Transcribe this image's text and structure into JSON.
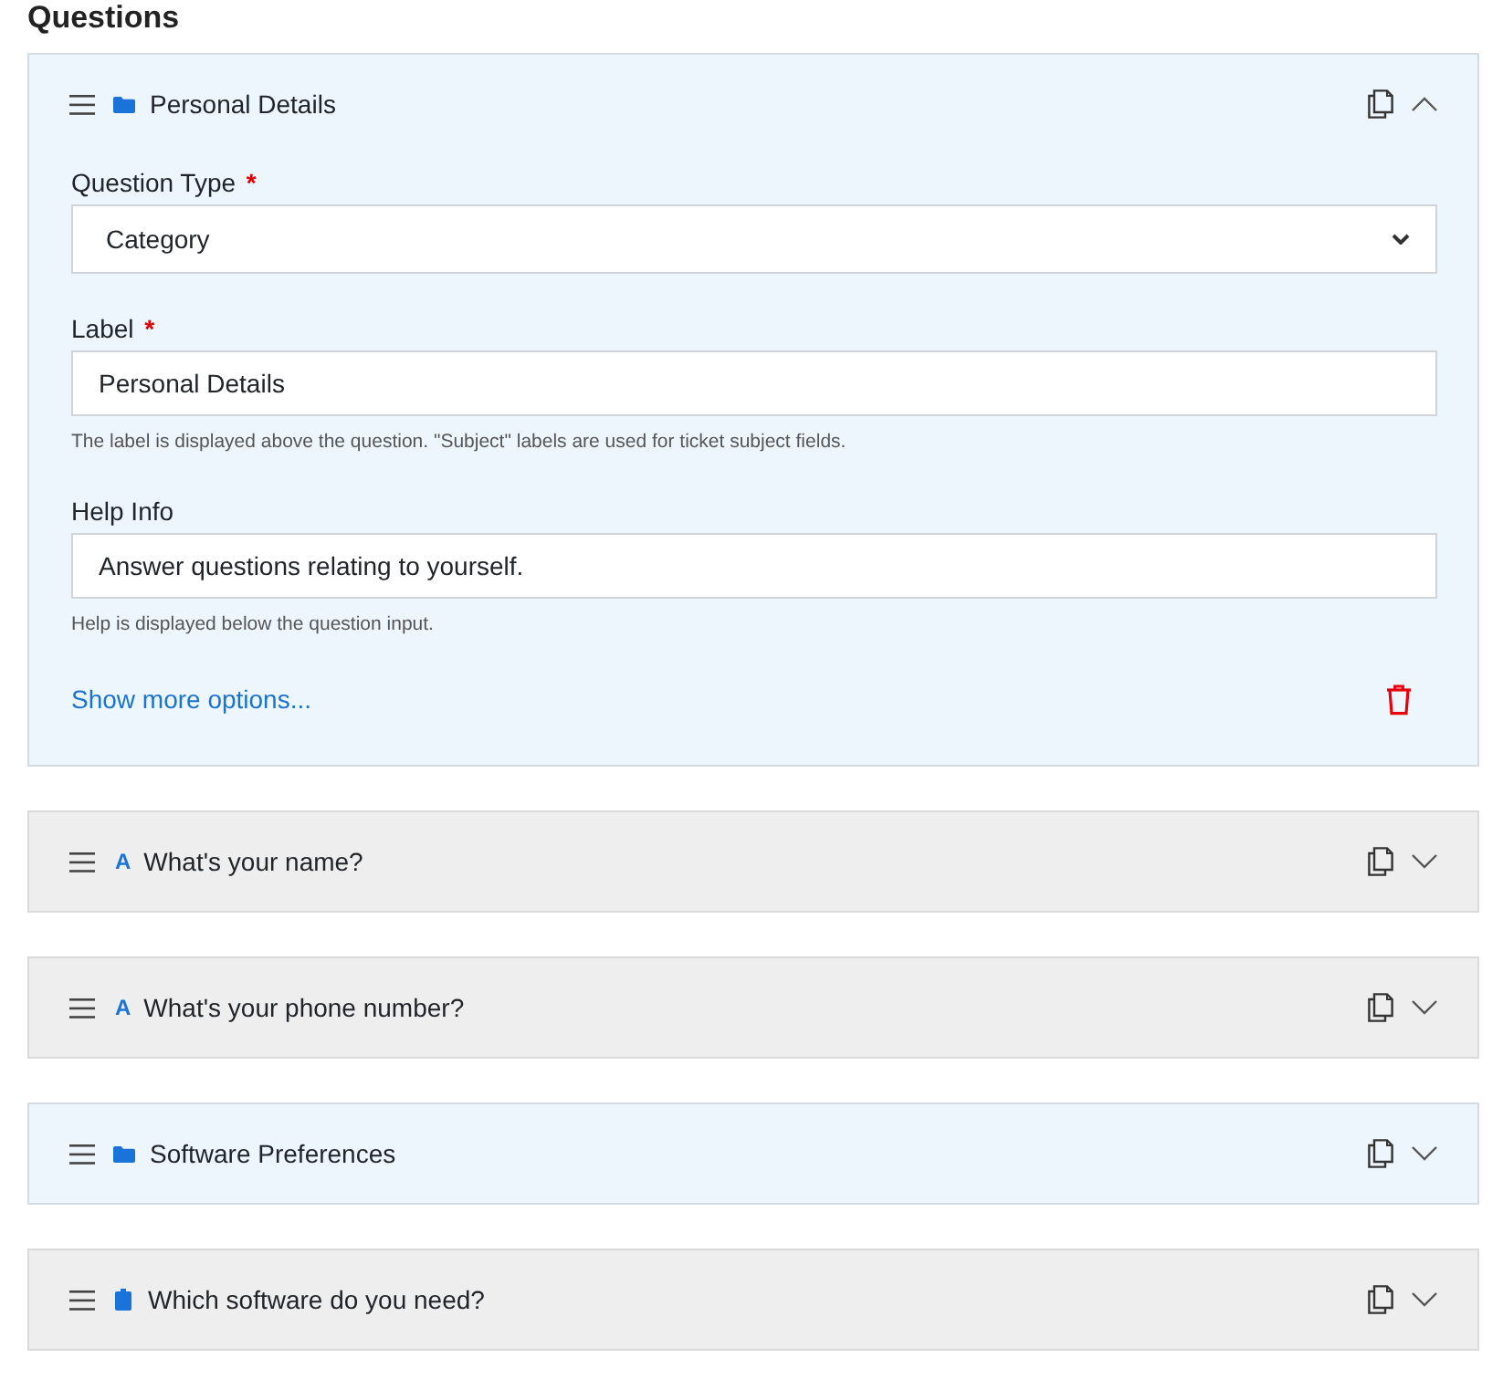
{
  "heading": "Questions",
  "questions": [
    {
      "kind": "category",
      "title": "Personal Details",
      "expanded": true,
      "form": {
        "fields": [
          {
            "kind": "select",
            "label": "Question Type",
            "required_mark": "*",
            "value": "Category"
          },
          {
            "kind": "text",
            "label": "Label",
            "required_mark": "*",
            "value": "Personal Details",
            "help": "The label is displayed above the question. \"Subject\" labels are used for ticket subject fields."
          },
          {
            "kind": "text",
            "label": "Help Info",
            "value": "Answer questions relating to yourself.",
            "help": "Help is displayed below the question input."
          }
        ],
        "more_options_link": "Show more options..."
      }
    },
    {
      "kind": "text",
      "icon_char": "A",
      "title": "What's your name?",
      "expanded": false
    },
    {
      "kind": "text",
      "icon_char": "A",
      "title": "What's your phone number?",
      "expanded": false
    },
    {
      "kind": "category",
      "title": "Software Preferences",
      "expanded": false
    },
    {
      "kind": "choice",
      "title": "Which software do you need?",
      "expanded": false
    }
  ]
}
